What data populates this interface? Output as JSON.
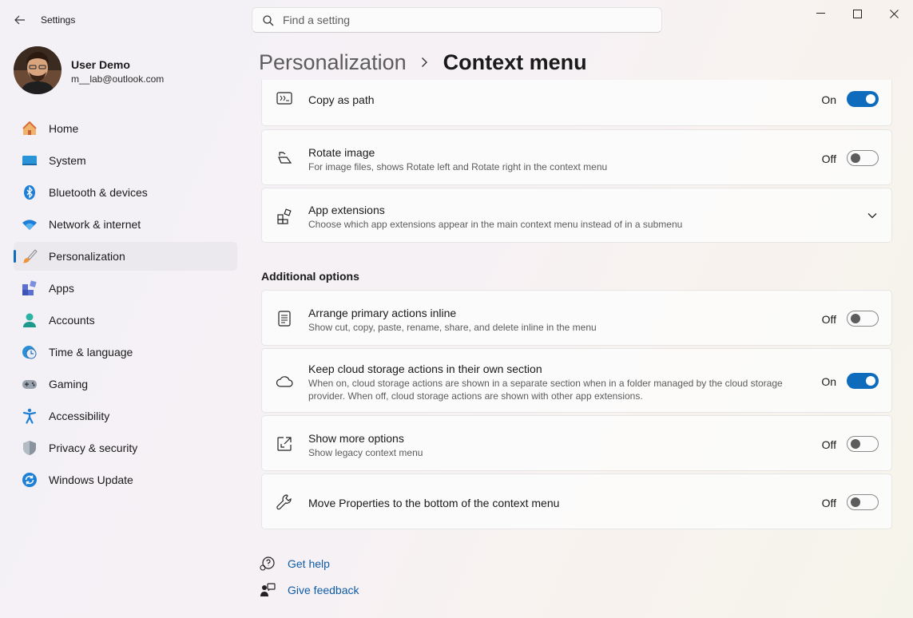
{
  "app": {
    "title": "Settings"
  },
  "search": {
    "placeholder": "Find a setting"
  },
  "user": {
    "name": "User Demo",
    "email": "m__lab@outlook.com"
  },
  "nav": [
    {
      "label": "Home",
      "icon": "home-icon"
    },
    {
      "label": "System",
      "icon": "system-icon"
    },
    {
      "label": "Bluetooth & devices",
      "icon": "bluetooth-icon"
    },
    {
      "label": "Network & internet",
      "icon": "wifi-icon"
    },
    {
      "label": "Personalization",
      "icon": "brush-icon",
      "active": true
    },
    {
      "label": "Apps",
      "icon": "apps-icon"
    },
    {
      "label": "Accounts",
      "icon": "account-icon"
    },
    {
      "label": "Time & language",
      "icon": "clock-globe-icon"
    },
    {
      "label": "Gaming",
      "icon": "gamepad-icon"
    },
    {
      "label": "Accessibility",
      "icon": "accessibility-icon"
    },
    {
      "label": "Privacy & security",
      "icon": "shield-icon"
    },
    {
      "label": "Windows Update",
      "icon": "update-icon"
    }
  ],
  "breadcrumb": {
    "parent": "Personalization",
    "current": "Context menu"
  },
  "settings": {
    "copy_path": {
      "title": "Copy as path",
      "state": "On",
      "enabled": true
    },
    "rotate": {
      "title": "Rotate image",
      "desc": "For image files, shows Rotate left and Rotate right in the context menu",
      "state": "Off",
      "enabled": false
    },
    "extensions": {
      "title": "App extensions",
      "desc": "Choose which app extensions appear in the main context menu instead of in a submenu"
    }
  },
  "additional": {
    "heading": "Additional options",
    "inline": {
      "title": "Arrange primary actions inline",
      "desc": "Show cut, copy, paste, rename, share, and delete inline in the menu",
      "state": "Off",
      "enabled": false
    },
    "cloud": {
      "title": "Keep cloud storage actions in their own section",
      "desc": "When on, cloud storage actions are shown in a separate section when in a folder managed by the cloud storage provider. When off, cloud storage actions are shown with other app extensions.",
      "state": "On",
      "enabled": true
    },
    "more": {
      "title": "Show more options",
      "desc": "Show legacy context menu",
      "state": "Off",
      "enabled": false
    },
    "properties": {
      "title": "Move Properties to the bottom of the context menu",
      "state": "Off",
      "enabled": false
    }
  },
  "footer": {
    "help": "Get help",
    "feedback": "Give feedback"
  },
  "colors": {
    "accent": "#0f6cbd",
    "link": "#0f5ca8"
  }
}
